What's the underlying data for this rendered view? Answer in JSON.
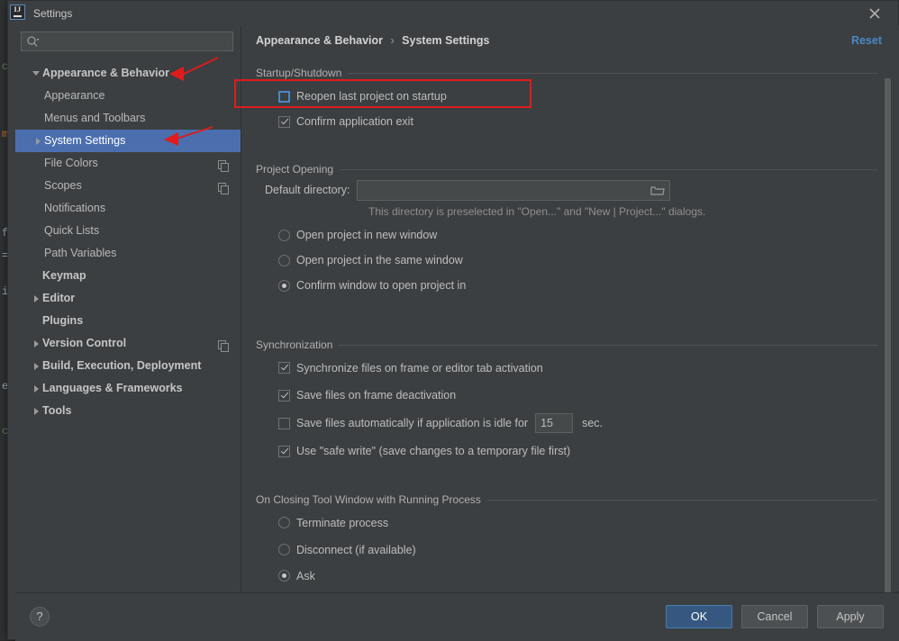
{
  "window": {
    "title": "Settings",
    "logo_text": "IJ",
    "close_icon": "close-icon"
  },
  "sidebar": {
    "search": {
      "value": "",
      "placeholder": "",
      "icon": "search-icon"
    },
    "tree": [
      {
        "label": "Appearance & Behavior",
        "level": 0,
        "arrow": "down",
        "bold": true,
        "selected": false,
        "copy_icon": false
      },
      {
        "label": "Appearance",
        "level": 1,
        "arrow": "none",
        "bold": false,
        "selected": false,
        "copy_icon": false
      },
      {
        "label": "Menus and Toolbars",
        "level": 1,
        "arrow": "none",
        "bold": false,
        "selected": false,
        "copy_icon": false
      },
      {
        "label": "System Settings",
        "level": 1,
        "arrow": "right",
        "bold": false,
        "selected": true,
        "copy_icon": false
      },
      {
        "label": "File Colors",
        "level": 1,
        "arrow": "none",
        "bold": false,
        "selected": false,
        "copy_icon": true
      },
      {
        "label": "Scopes",
        "level": 1,
        "arrow": "none",
        "bold": false,
        "selected": false,
        "copy_icon": true
      },
      {
        "label": "Notifications",
        "level": 1,
        "arrow": "none",
        "bold": false,
        "selected": false,
        "copy_icon": false
      },
      {
        "label": "Quick Lists",
        "level": 1,
        "arrow": "none",
        "bold": false,
        "selected": false,
        "copy_icon": false
      },
      {
        "label": "Path Variables",
        "level": 1,
        "arrow": "none",
        "bold": false,
        "selected": false,
        "copy_icon": false
      },
      {
        "label": "Keymap",
        "level": 0,
        "arrow": "none",
        "bold": true,
        "selected": false,
        "copy_icon": false
      },
      {
        "label": "Editor",
        "level": 0,
        "arrow": "right",
        "bold": true,
        "selected": false,
        "copy_icon": false
      },
      {
        "label": "Plugins",
        "level": 0,
        "arrow": "none",
        "bold": true,
        "selected": false,
        "copy_icon": false
      },
      {
        "label": "Version Control",
        "level": 0,
        "arrow": "right",
        "bold": true,
        "selected": false,
        "copy_icon": true
      },
      {
        "label": "Build, Execution, Deployment",
        "level": 0,
        "arrow": "right",
        "bold": true,
        "selected": false,
        "copy_icon": false
      },
      {
        "label": "Languages & Frameworks",
        "level": 0,
        "arrow": "right",
        "bold": true,
        "selected": false,
        "copy_icon": false
      },
      {
        "label": "Tools",
        "level": 0,
        "arrow": "right",
        "bold": true,
        "selected": false,
        "copy_icon": false
      }
    ]
  },
  "content": {
    "breadcrumb_root": "Appearance & Behavior",
    "breadcrumb_separator": "›",
    "breadcrumb_leaf": "System Settings",
    "reset_label": "Reset",
    "startup": {
      "title": "Startup/Shutdown",
      "reopen_last_project": {
        "label": "Reopen last project on startup",
        "checked": false,
        "focused": true
      },
      "confirm_exit": {
        "label": "Confirm application exit",
        "checked": true,
        "focused": false
      }
    },
    "project_opening": {
      "title": "Project Opening",
      "default_directory_label": "Default directory:",
      "default_directory_value": "",
      "default_directory_placeholder": "",
      "browse_icon": "folder-icon",
      "hint": "This directory is preselected in \"Open...\" and \"New | Project...\" dialogs.",
      "options": [
        {
          "label": "Open project in new window",
          "selected": false
        },
        {
          "label": "Open project in the same window",
          "selected": false
        },
        {
          "label": "Confirm window to open project in",
          "selected": true
        }
      ]
    },
    "synchronization": {
      "title": "Synchronization",
      "options": [
        {
          "label": "Synchronize files on frame or editor tab activation",
          "checked": true
        },
        {
          "label": "Save files on frame deactivation",
          "checked": true
        }
      ],
      "idle": {
        "label": "Save files automatically if application is idle for",
        "checked": false,
        "value": "15",
        "unit": "sec."
      },
      "safe_write": {
        "label": "Use \"safe write\" (save changes to a temporary file first)",
        "checked": true
      }
    },
    "closing_tool_window": {
      "title": "On Closing Tool Window with Running Process",
      "options": [
        {
          "label": "Terminate process",
          "selected": false
        },
        {
          "label": "Disconnect (if available)",
          "selected": false
        },
        {
          "label": "Ask",
          "selected": true
        }
      ]
    }
  },
  "footer": {
    "help_label": "?",
    "ok_label": "OK",
    "cancel_label": "Cancel",
    "apply_label": "Apply"
  },
  "annotations": {
    "highlight_color": "#e01b1b",
    "arrow_to_appearance_behavior": "arrow-icon",
    "arrow_to_system_settings": "arrow-icon",
    "highlight_box_target": "reopen-last-project-checkbox"
  },
  "backdrop": {
    "fragments": [
      "c",
      "m",
      "f",
      "=",
      "i",
      "e",
      "c"
    ]
  },
  "colors": {
    "dialog_bg": "#3c3f41",
    "selection_blue": "#4b6eaf",
    "accent_blue": "#4a88c7",
    "primary_button": "#365880"
  }
}
